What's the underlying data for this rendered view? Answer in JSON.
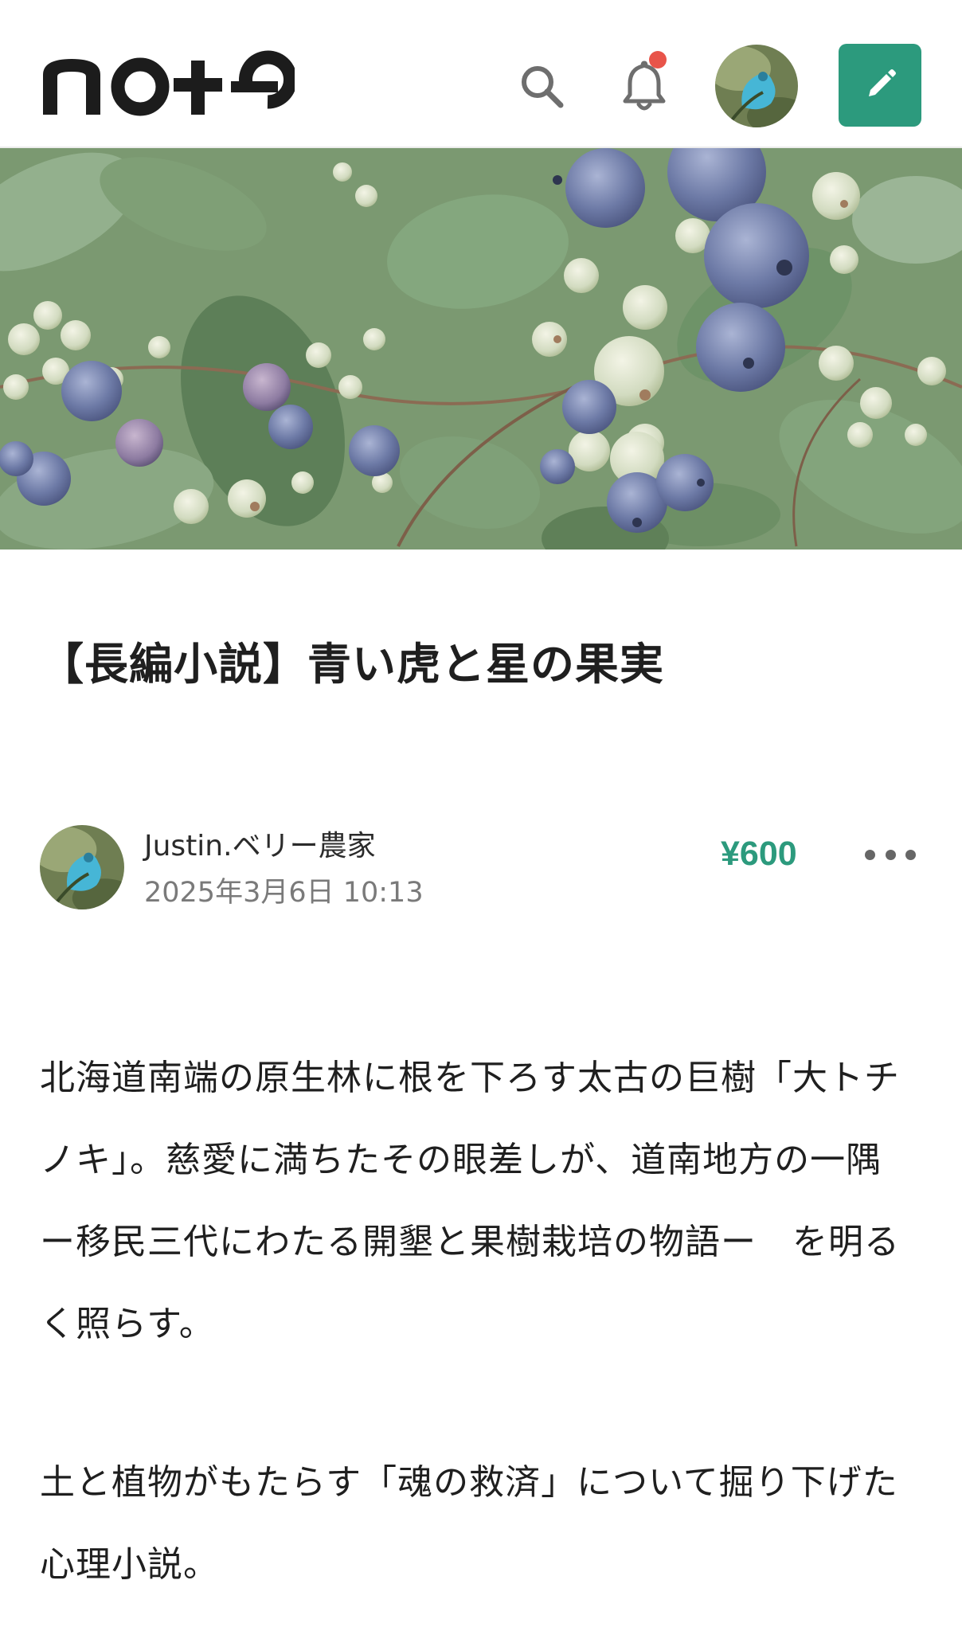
{
  "header": {
    "logo_text": "note",
    "icons": {
      "search": "search-icon",
      "notifications": "bell-icon",
      "user": "avatar",
      "post": "pencil-icon"
    },
    "has_unread_notification": true
  },
  "article": {
    "title": "【長編小説】青い虎と星の果実",
    "author": {
      "name": "Justin.ベリー農家",
      "date": "2025年3月6日 10:13"
    },
    "price": "¥600",
    "paragraphs": [
      "北海道南端の原生林に根を下ろす太古の巨樹「大トチノキ」。慈愛に満ちたその眼差しが、道南地方の一隅　ー移民三代にわたる開墾と果樹栽培の物語ー　を明るく照らす。",
      "土と植物がもたらす「魂の救済」について掘り下げた心理小説。"
    ]
  },
  "colors": {
    "accent": "#2c9a7d",
    "notification_dot": "#e8544a",
    "text": "#1f1f1f",
    "muted": "#7a7a7a"
  }
}
